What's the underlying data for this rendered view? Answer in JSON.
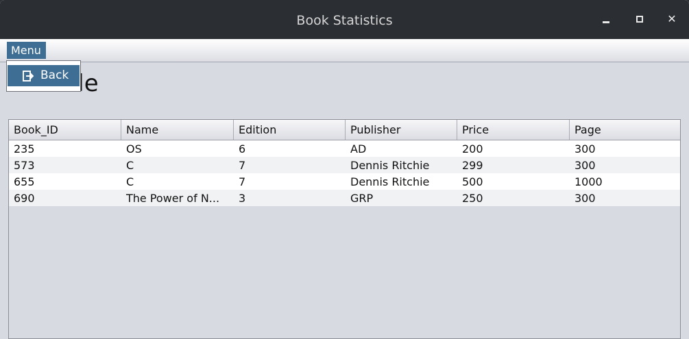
{
  "window": {
    "title": "Book Statistics",
    "controls": {
      "minimize": "minimize-icon",
      "maximize": "maximize-icon",
      "close": "close-icon"
    }
  },
  "menubar": {
    "menu_label": "Menu",
    "dropdown": {
      "back_label": "Back",
      "back_icon": "exit-icon"
    }
  },
  "heading": "nt Table",
  "table": {
    "columns": [
      "Book_ID",
      "Name",
      "Edition",
      "Publisher",
      "Price",
      "Page"
    ],
    "rows": [
      [
        "235",
        "OS",
        "6",
        "AD",
        "200",
        "300"
      ],
      [
        "573",
        "C",
        "7",
        "Dennis Ritchie",
        "299",
        "300"
      ],
      [
        "655",
        "C",
        "7",
        "Dennis Ritchie",
        "500",
        "1000"
      ],
      [
        "690",
        "The Power of N...",
        "3",
        "GRP",
        "250",
        "300"
      ]
    ]
  },
  "colors": {
    "accent": "#3f6e95",
    "titlebar": "#2b2e32",
    "window_bg": "#d8dae2"
  }
}
